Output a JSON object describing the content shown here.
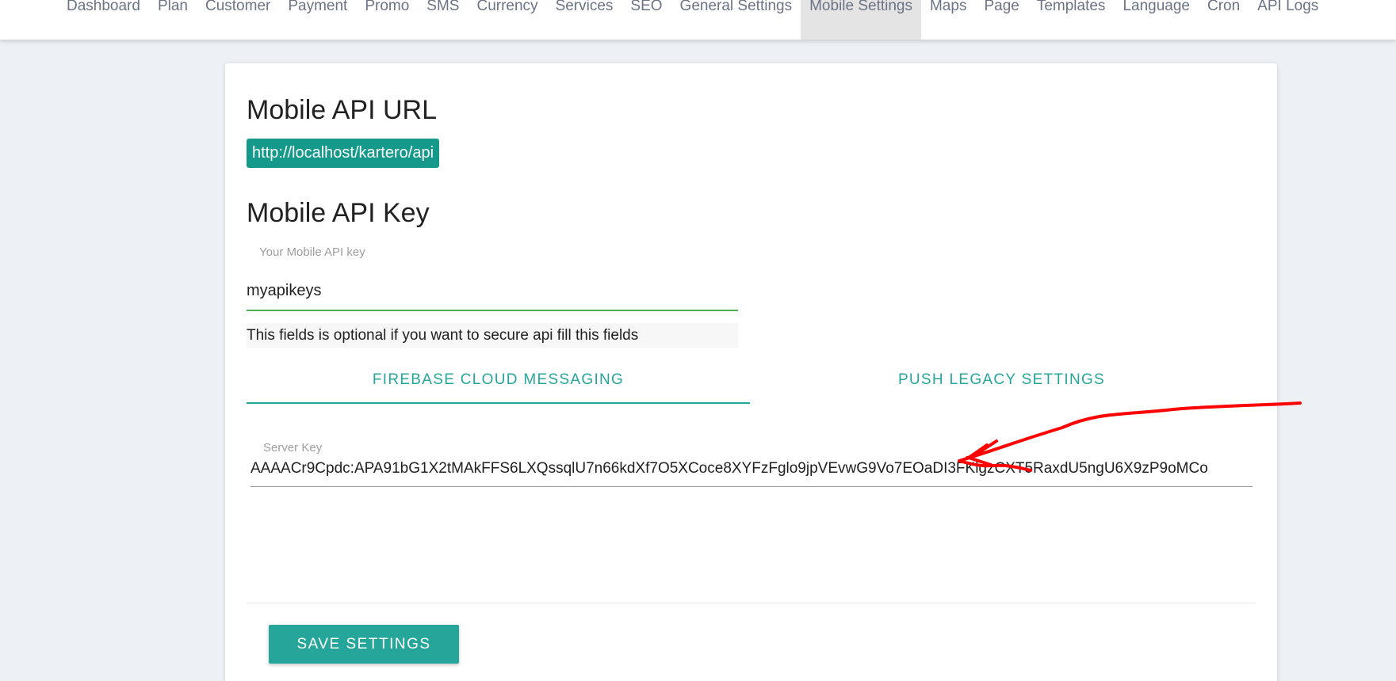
{
  "nav": {
    "items": [
      {
        "label": "Dashboard"
      },
      {
        "label": "Plan"
      },
      {
        "label": "Customer"
      },
      {
        "label": "Payment"
      },
      {
        "label": "Promo"
      },
      {
        "label": "SMS"
      },
      {
        "label": "Currency"
      },
      {
        "label": "Services"
      },
      {
        "label": "SEO"
      },
      {
        "label": "General Settings"
      },
      {
        "label": "Mobile Settings",
        "active": true
      },
      {
        "label": "Maps"
      },
      {
        "label": "Page"
      },
      {
        "label": "Templates"
      },
      {
        "label": "Language"
      },
      {
        "label": "Cron"
      },
      {
        "label": "API Logs"
      }
    ]
  },
  "mobile_api_url": {
    "heading": "Mobile API URL",
    "value": "http://localhost/kartero/api"
  },
  "mobile_api_key": {
    "heading": "Mobile API Key",
    "field_label": "Your Mobile API key",
    "value": "myapikeys",
    "helper_text": "This fields is optional if you want to secure api fill this fields"
  },
  "tabs": [
    {
      "label": "FIREBASE CLOUD MESSAGING",
      "active": true
    },
    {
      "label": "PUSH LEGACY SETTINGS",
      "active": false
    }
  ],
  "server_key": {
    "field_label": "Server Key",
    "value": "AAAACr9Cpdc:APA91bG1X2tMAkFFS6LXQssqlU7n66kdXf7O5XCoce8XYFzFglo9jpVEvwG9Vo7EOaDI3FKlgzCXT5RaxdU5ngU6X9zP9oMCo"
  },
  "save_button": {
    "label": "SAVE SETTINGS"
  },
  "colors": {
    "accent": "#26a69a",
    "url_badge": "#15998a",
    "active_field_underline": "#4caf50",
    "annotation": "#ff0000"
  }
}
